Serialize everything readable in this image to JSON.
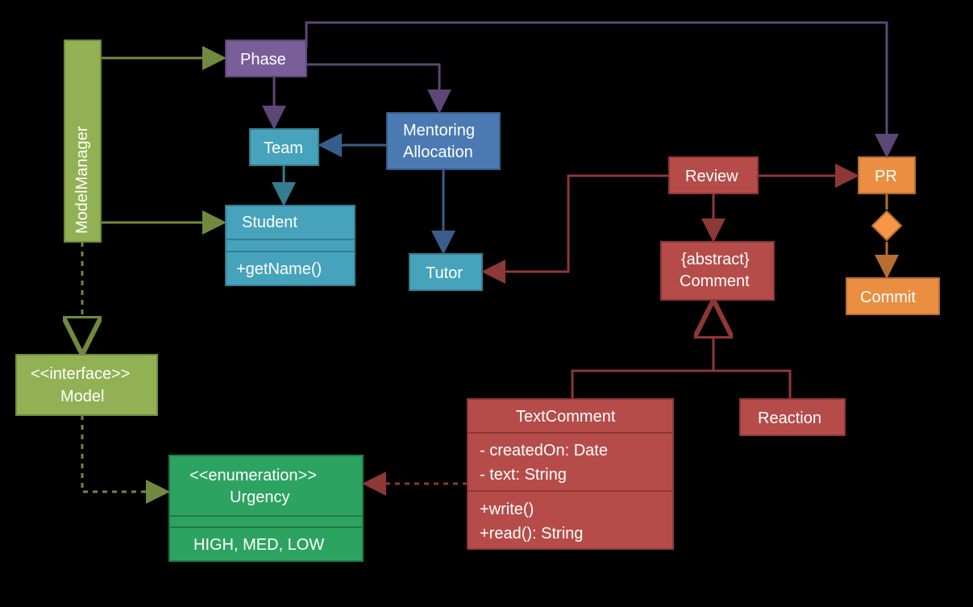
{
  "colors": {
    "olive_fill": "#9ABB59",
    "olive_stroke": "#71893F",
    "purple_fill": "#7F63A1",
    "purple_stroke": "#5C4776",
    "teal_fill": "#4BACC6",
    "teal_stroke": "#357D91",
    "blue_fill": "#4F81BD",
    "blue_stroke": "#385D8A",
    "red_fill": "#C0504D",
    "red_stroke": "#8C3836",
    "orange_fill": "#F79646",
    "orange_stroke": "#B66D31",
    "green_fill": "#2FAC66",
    "green_stroke": "#1F7A47"
  },
  "nodes": {
    "modelmanager": {
      "label": "ModelManager"
    },
    "phase": {
      "label": "Phase"
    },
    "team": {
      "label": "Team"
    },
    "mentoring": {
      "line1": "Mentoring",
      "line2": "Allocation"
    },
    "student": {
      "title": "Student",
      "method": "+getName()"
    },
    "tutor": {
      "label": "Tutor"
    },
    "model": {
      "stereo": "<<interface>>",
      "name": "Model"
    },
    "urgency": {
      "stereo": "<<enumeration>>",
      "name": "Urgency",
      "values": "HIGH, MED, LOW"
    },
    "review": {
      "label": "Review"
    },
    "comment": {
      "line1": "{abstract}",
      "line2": "Comment"
    },
    "textcomment": {
      "title": "TextComment",
      "attr1": "- createdOn: Date",
      "attr2": "- text: String",
      "m1": "+write()",
      "m2": "+read(): String"
    },
    "reaction": {
      "label": "Reaction"
    },
    "pr": {
      "label": "PR"
    },
    "commit": {
      "label": "Commit"
    }
  }
}
